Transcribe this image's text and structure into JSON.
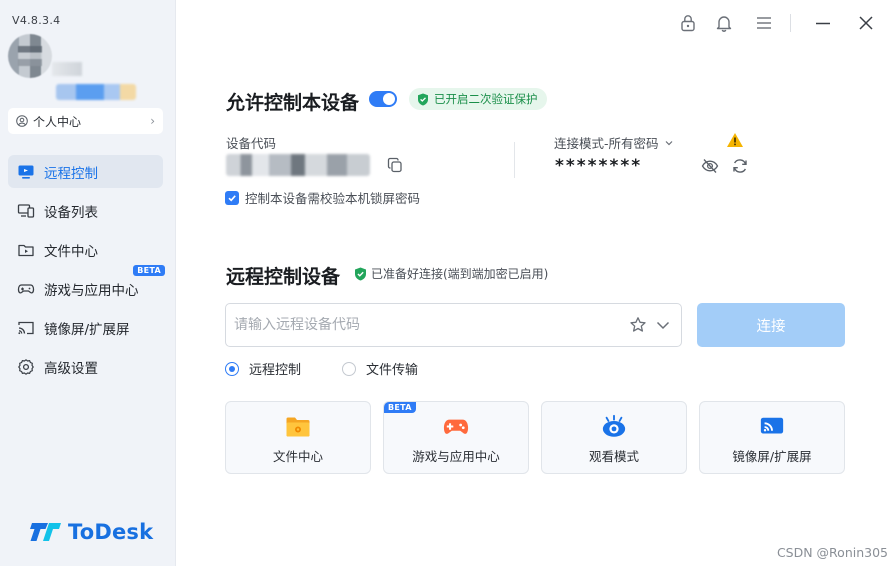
{
  "app": {
    "version": "V4.8.3.4",
    "brand_name": "ToDesk"
  },
  "sidebar": {
    "personal_center_label": "个人中心",
    "items": [
      {
        "label": "远程控制",
        "icon": "monitor-icon",
        "active": true
      },
      {
        "label": "设备列表",
        "icon": "devices-icon",
        "active": false
      },
      {
        "label": "文件中心",
        "icon": "folder-icon",
        "active": false
      },
      {
        "label": "游戏与应用中心",
        "icon": "gamepad-icon",
        "active": false,
        "badge": "BETA"
      },
      {
        "label": "镜像屏/扩展屏",
        "icon": "cast-icon",
        "active": false
      },
      {
        "label": "高级设置",
        "icon": "gear-icon",
        "active": false
      }
    ]
  },
  "titlebar": {
    "icons": [
      "lock-icon",
      "bell-icon",
      "menu-icon",
      "minimize-icon",
      "close-icon"
    ]
  },
  "allow_control": {
    "title": "允许控制本设备",
    "enabled": true,
    "protection_badge": "已开启二次验证保护",
    "device_code_label": "设备代码",
    "connection_mode_label": "连接模式-所有密码",
    "password_masked": "********",
    "lock_screen_check_label": "控制本设备需校验本机锁屏密码",
    "lock_screen_checked": true
  },
  "remote_control": {
    "title": "远程控制设备",
    "ready_text": "已准备好连接(端到端加密已启用)",
    "input_placeholder": "请输入远程设备代码",
    "input_value": "",
    "connect_label": "连接",
    "modes": [
      {
        "label": "远程控制",
        "selected": true
      },
      {
        "label": "文件传输",
        "selected": false
      }
    ],
    "cards": [
      {
        "label": "文件中心",
        "icon": "folder-icon"
      },
      {
        "label": "游戏与应用中心",
        "icon": "gamepad-icon",
        "badge": "BETA"
      },
      {
        "label": "观看模式",
        "icon": "eye-icon"
      },
      {
        "label": "镜像屏/扩展屏",
        "icon": "cast-icon"
      }
    ]
  },
  "watermark": "CSDN @Ronin305",
  "colors": {
    "accent": "#2f7cf6",
    "brand": "#1870e0",
    "success": "#1b8f4a",
    "warning": "#f5b400",
    "connect_disabled": "#a3cdf8"
  }
}
